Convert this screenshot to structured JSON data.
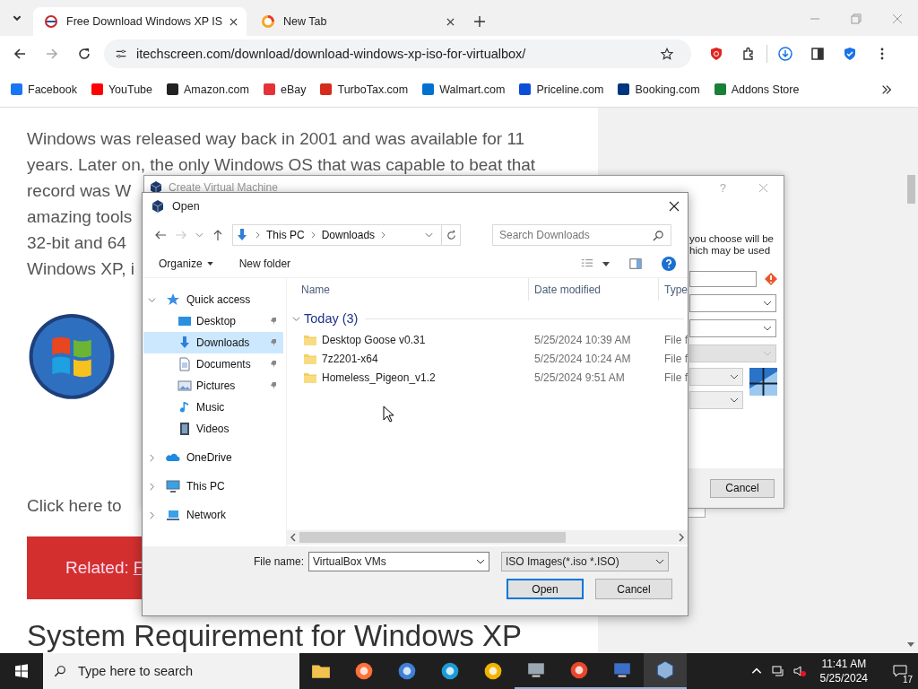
{
  "browser": {
    "tabs": [
      {
        "title": "Free Download Windows XP IS",
        "selected": true
      },
      {
        "title": "New Tab",
        "selected": false
      }
    ],
    "url": "itechscreen.com/download/download-windows-xp-iso-for-virtualbox/",
    "bookmarks": [
      "Facebook",
      "YouTube",
      "Amazon.com",
      "eBay",
      "TurboTax.com",
      "Walmart.com",
      "Priceline.com",
      "Booking.com",
      "Addons Store"
    ]
  },
  "article": {
    "paragraph_lines": [
      "Windows was released way back in 2001 and was available for 11",
      "years. Later on, the only Windows OS that was capable to beat that",
      "record was W",
      "amazing tools",
      "32-bit and 64",
      "Windows XP, i"
    ],
    "click_text": "Click here to",
    "related_label": "Related:",
    "related_link": "F",
    "heading": "System Requirement for Windows XP"
  },
  "vm_dialog": {
    "title": "Create Virtual Machine",
    "help": "?",
    "text_lines": [
      "you choose will be",
      "hich may be used"
    ],
    "cancel": "Cancel"
  },
  "open_dialog": {
    "title": "Open",
    "path": [
      "This PC",
      "Downloads"
    ],
    "search_placeholder": "Search Downloads",
    "organize": "Organize",
    "new_folder": "New folder",
    "nav": [
      {
        "label": "Quick access",
        "kind": "star",
        "expanded": true,
        "selected": false,
        "children": [
          {
            "label": "Desktop",
            "kind": "desktop",
            "pinned": true,
            "selected": false
          },
          {
            "label": "Downloads",
            "kind": "downloads",
            "pinned": true,
            "selected": true
          },
          {
            "label": "Documents",
            "kind": "documents",
            "pinned": true,
            "selected": false
          },
          {
            "label": "Pictures",
            "kind": "pictures",
            "pinned": true,
            "selected": false
          },
          {
            "label": "Music",
            "kind": "music",
            "pinned": false,
            "selected": false
          },
          {
            "label": "Videos",
            "kind": "videos",
            "pinned": false,
            "selected": false
          }
        ]
      },
      {
        "label": "OneDrive",
        "kind": "cloud",
        "expanded": false,
        "selected": false
      },
      {
        "label": "This PC",
        "kind": "pc",
        "expanded": false,
        "selected": false
      },
      {
        "label": "Network",
        "kind": "network",
        "expanded": false,
        "selected": false
      }
    ],
    "columns": [
      "Name",
      "Date modified",
      "Type"
    ],
    "group": {
      "label": "Today (3)",
      "expanded": true
    },
    "files": [
      {
        "name": "Desktop Goose v0.31",
        "date": "5/25/2024 10:39 AM",
        "type": "File f"
      },
      {
        "name": "7z2201-x64",
        "date": "5/25/2024 10:24 AM",
        "type": "File f"
      },
      {
        "name": "Homeless_Pigeon_v1.2",
        "date": "5/25/2024 9:51 AM",
        "type": "File f"
      }
    ],
    "file_name_label": "File name:",
    "file_name": "VirtualBox VMs",
    "filter": "ISO Images(*.iso *.ISO)",
    "buttons": [
      {
        "label": "Open",
        "default": true
      },
      {
        "label": "Cancel",
        "default": false
      }
    ]
  },
  "taskbar": {
    "search_placeholder": "Type here to search",
    "apps": [
      {
        "running": false,
        "selected": false
      },
      {
        "running": false,
        "selected": false
      },
      {
        "running": false,
        "selected": false
      },
      {
        "running": false,
        "selected": false
      },
      {
        "running": false,
        "selected": false
      },
      {
        "running": true,
        "selected": false
      },
      {
        "running": true,
        "selected": false
      },
      {
        "running": true,
        "selected": false
      },
      {
        "running": true,
        "selected": true
      }
    ],
    "time": "11:41 AM",
    "date": "5/25/2024",
    "notifications": "17"
  }
}
